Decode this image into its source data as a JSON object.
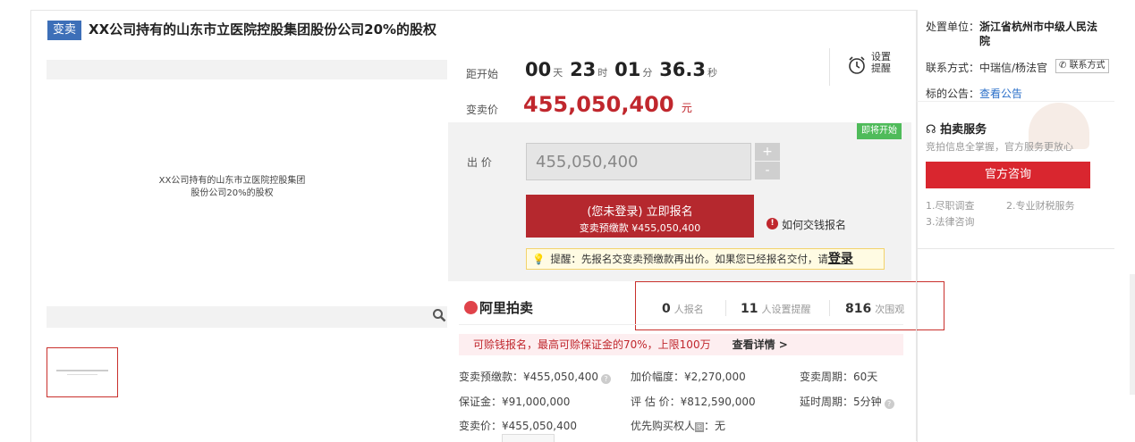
{
  "title": {
    "badge": "变卖",
    "text": "XX公司持有的山东市立医院控股集团股份公司20%的股权"
  },
  "image": {
    "alt_line1": "XX公司持有的山东市立医院控股集团",
    "alt_line2": "股份公司20%的股权"
  },
  "countdown": {
    "label": "距开始",
    "days": "00",
    "days_unit": "天",
    "hours": "23",
    "hours_unit": "时",
    "minutes": "01",
    "minutes_unit": "分",
    "seconds": "36.3",
    "seconds_unit": "秒",
    "remind_line1": "设置",
    "remind_line2": "提醒"
  },
  "price": {
    "label": "变卖价",
    "value": "455,050,400",
    "unit": "元"
  },
  "bid": {
    "status_badge": "即将开始",
    "label": "出 价",
    "input_value": "455,050,400",
    "plus": "+",
    "minus": "-",
    "signup_line1": "(您未登录) 立即报名",
    "signup_line2": "变卖预缴款 ¥455,050,400",
    "how_to_pay": "如何交钱报名",
    "tip_text": "提醒：先报名交变卖预缴款再出价。如果您已经报名交付，请",
    "tip_login": "登录"
  },
  "platform": {
    "name": "阿里拍卖"
  },
  "stats": [
    {
      "count": "0",
      "label": "人报名"
    },
    {
      "count": "11",
      "label": "人设置提醒"
    },
    {
      "count": "816",
      "label": "次围观"
    }
  ],
  "promo": {
    "text": "可赊钱报名，最高可赊保证金的70%，上限100万",
    "link": "查看详情 >"
  },
  "details": {
    "deposit_label": "变卖预缴款：¥455,050,400",
    "increment": "加价幅度：¥2,270,000",
    "period": "变卖周期：60天",
    "bond": "保证金：¥91,000,000",
    "valuation": "评 估 价：¥812,590,000",
    "delay": "延时周期：5分钟",
    "sale_price": "变卖价：¥455,050,400",
    "priority_label": "优先购买权人",
    "priority_tag": "图",
    "priority_value": "：无"
  },
  "right": {
    "org_label": "处置单位：",
    "org_value_line1": "浙江省杭州市中级人民法",
    "org_value_line2": "院",
    "contact_label": "联系方式：",
    "contact_value": "中瑞信/杨法官",
    "contact_button": "联系方式",
    "notice_label": "标的公告：",
    "notice_link": "查看公告",
    "service_title": "拍卖服务",
    "service_sub": "竞拍信息全掌握，官方服务更放心",
    "consult_button": "官方咨询",
    "service_items": [
      "1.尽职调查",
      "2.专业财税服务",
      "3.法律咨询"
    ]
  },
  "colors": {
    "accent_red": "#c0272d",
    "badge_blue": "#3d6fb8",
    "soon_green": "#4fbb5a",
    "link_blue": "#2a6fc9"
  }
}
